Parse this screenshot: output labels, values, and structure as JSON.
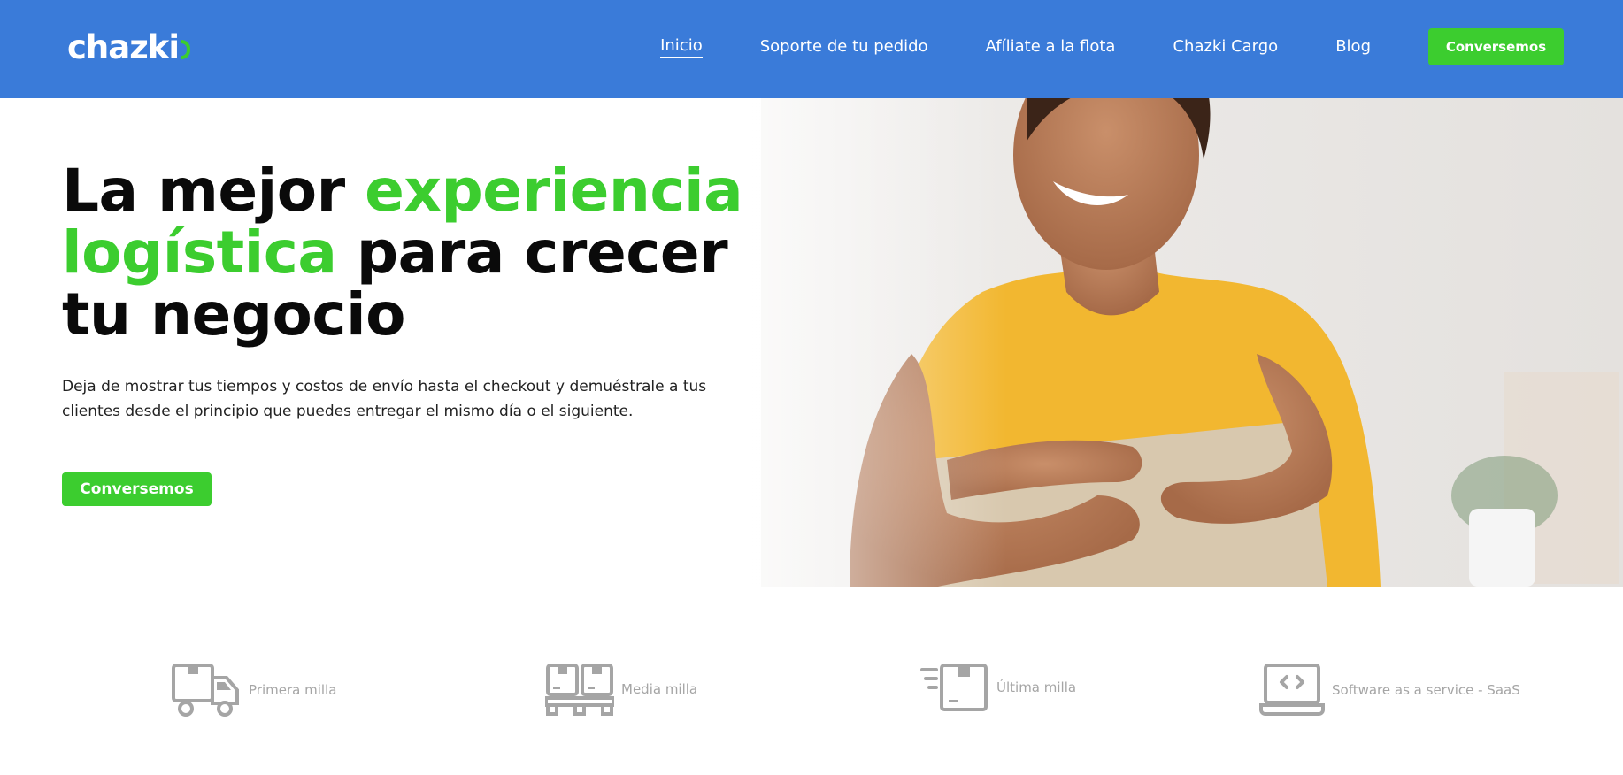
{
  "header": {
    "logo": "chazki",
    "nav": [
      "Inicio",
      "Soporte de tu pedido",
      "Afíliate a la flota",
      "Chazki Cargo",
      "Blog"
    ],
    "cta_label": "Conversemos"
  },
  "hero": {
    "title_part1": "La mejor ",
    "title_green": "experiencia logística",
    "title_part2": " para crecer tu negocio",
    "subtitle": "Deja de mostrar tus tiempos y costos de envío hasta el checkout y demuéstrale a tus clientes desde el principio que puedes entregar el mismo día o el siguiente.",
    "cta_label": "Conversemos"
  },
  "services": [
    {
      "icon": "truck-icon",
      "label": "Primera milla"
    },
    {
      "icon": "pallet-boxes-icon",
      "label": "Media milla"
    },
    {
      "icon": "fast-box-icon",
      "label": "Última milla"
    },
    {
      "icon": "laptop-code-icon",
      "label": "Software as a service - SaaS"
    }
  ],
  "colors": {
    "header": "#3a7bd9",
    "accent_green": "#3ccd2f",
    "icon_gray": "#a5a5a5"
  }
}
